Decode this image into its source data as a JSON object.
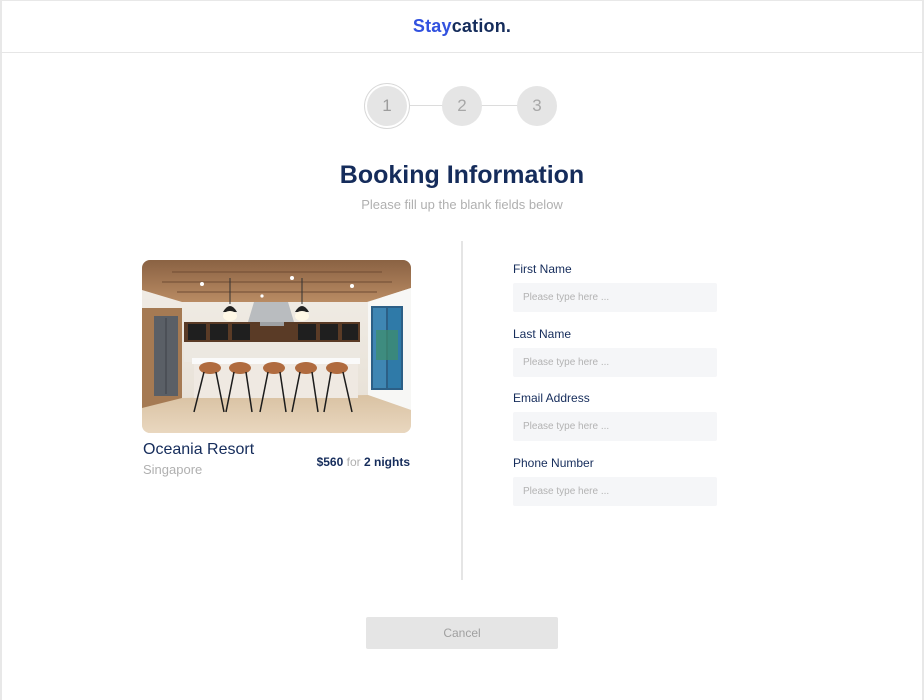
{
  "brand": {
    "part1": "Stay",
    "part2": "cation."
  },
  "stepper": {
    "steps": [
      "1",
      "2",
      "3"
    ],
    "active_step": "1"
  },
  "page": {
    "title": "Booking Information",
    "subtitle": "Please fill up the blank fields below"
  },
  "listing": {
    "name": "Oceania Resort",
    "location": "Singapore",
    "price": "$560",
    "price_for": "for",
    "duration": "2 nights"
  },
  "form": {
    "fields": [
      {
        "label": "First Name",
        "value": "",
        "placeholder": "Please type here ..."
      },
      {
        "label": "Last Name",
        "value": "",
        "placeholder": "Please type here ..."
      },
      {
        "label": "Email Address",
        "value": "",
        "placeholder": "Please type here ..."
      },
      {
        "label": "Phone Number",
        "value": "",
        "placeholder": "Please type here ..."
      }
    ]
  },
  "actions": {
    "cancel_label": "Cancel"
  },
  "colors": {
    "brand_blue": "#3252df",
    "navy": "#152c5b",
    "muted_gray": "#b0b0b0",
    "input_bg": "#f5f6f8",
    "step_bg": "#e5e5e5"
  }
}
